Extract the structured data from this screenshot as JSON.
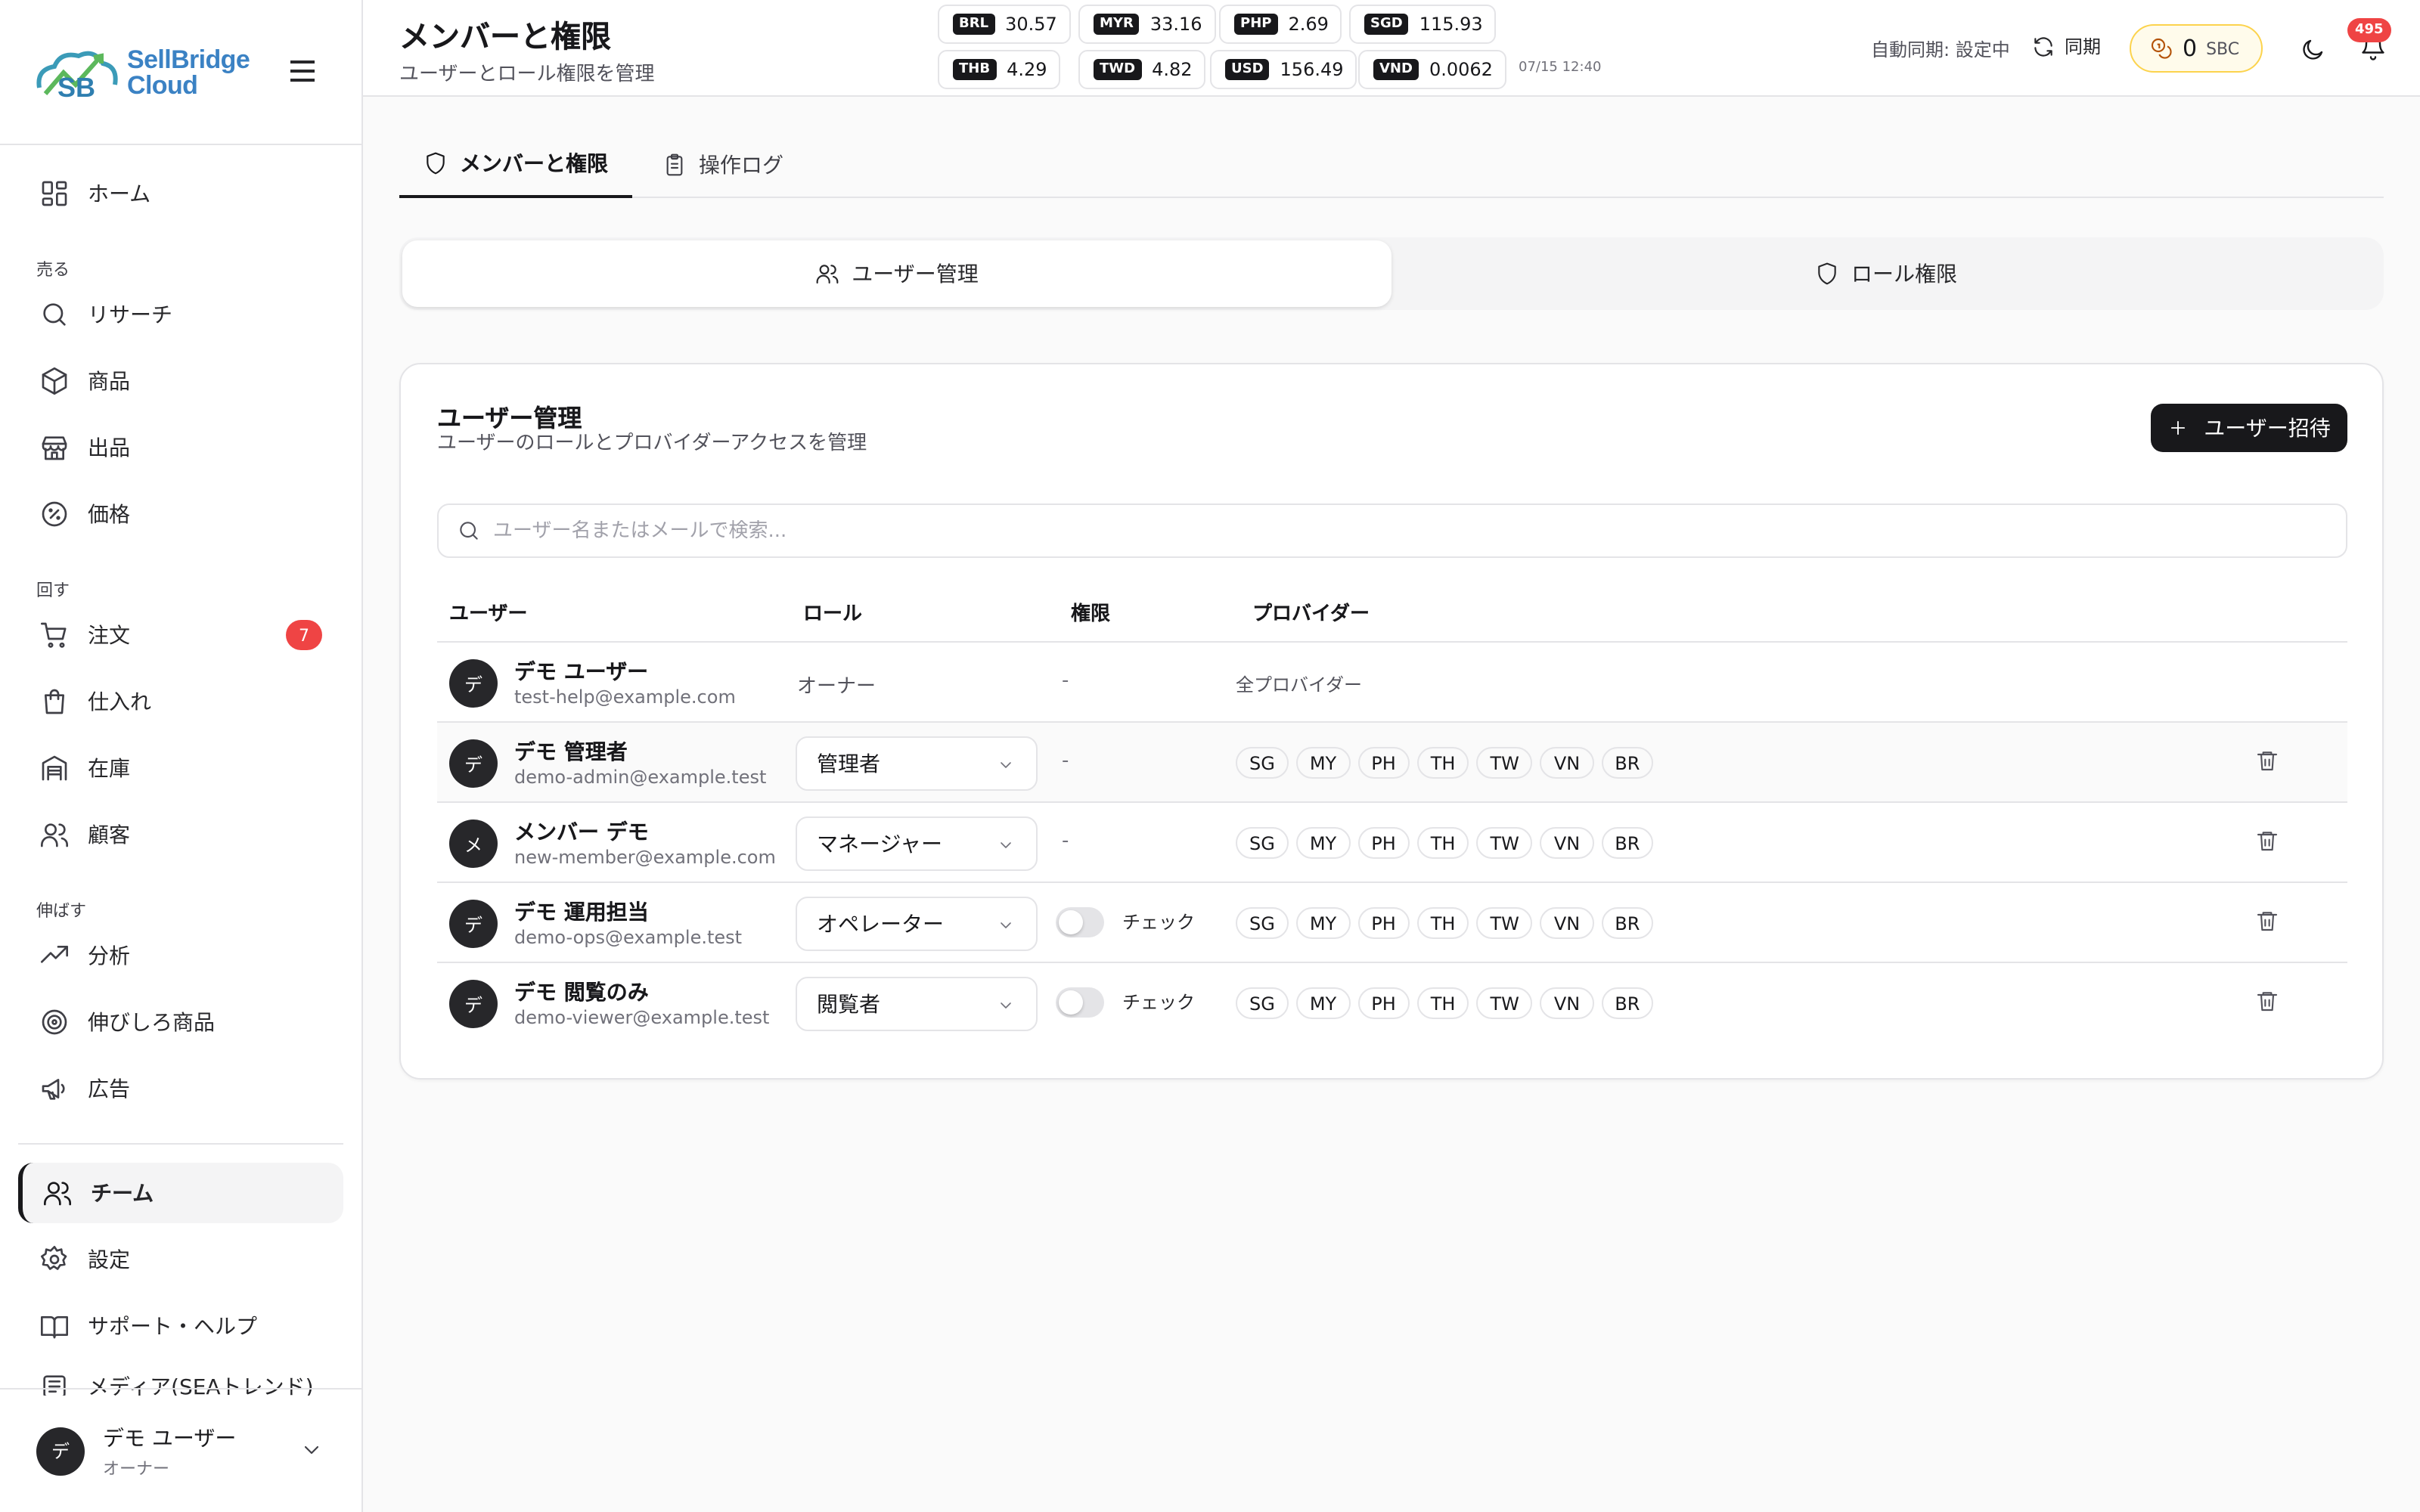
{
  "app": {
    "logo_line1": "SellBridge",
    "logo_line2": "Cloud"
  },
  "sidebar": {
    "home": "ホーム",
    "section_sell": "売る",
    "research": "リサーチ",
    "products": "商品",
    "listing": "出品",
    "pricing": "価格",
    "section_turn": "回す",
    "orders": "注文",
    "orders_badge": "7",
    "purchasing": "仕入れ",
    "inventory": "在庫",
    "customers": "顧客",
    "section_grow": "伸ばす",
    "analytics": "分析",
    "growth_products": "伸びしろ商品",
    "ads": "広告",
    "team": "チーム",
    "settings": "設定",
    "support": "サポート・ヘルプ",
    "media": "メディア(SEAトレンド)",
    "user_name": "デモ ユーザー",
    "user_role": "オーナー",
    "user_initial": "デ"
  },
  "header": {
    "title": "メンバーと権限",
    "subtitle": "ユーザーとロール権限を管理",
    "rates": [
      {
        "code": "BRL",
        "value": "30.57"
      },
      {
        "code": "MYR",
        "value": "33.16"
      },
      {
        "code": "PHP",
        "value": "2.69"
      },
      {
        "code": "SGD",
        "value": "115.93"
      },
      {
        "code": "THB",
        "value": "4.29"
      },
      {
        "code": "TWD",
        "value": "4.82"
      },
      {
        "code": "USD",
        "value": "156.49"
      },
      {
        "code": "VND",
        "value": "0.0062"
      }
    ],
    "rate_time": "07/15 12:40",
    "auto_sync": "自動同期: 設定中",
    "sync_label": "同期",
    "sbc_amount": "0",
    "sbc_unit": "SBC",
    "notif_count": "495"
  },
  "tabs": {
    "members": "メンバーと権限",
    "oplog": "操作ログ"
  },
  "segment": {
    "users": "ユーザー管理",
    "roles": "ロール権限"
  },
  "card": {
    "title": "ユーザー管理",
    "subtitle": "ユーザーのロールとプロバイダーアクセスを管理",
    "invite_label": "ユーザー招待",
    "search_placeholder": "ユーザー名またはメールで検索..."
  },
  "table": {
    "headers": [
      "ユーザー",
      "ロール",
      "権限",
      "プロバイダー"
    ],
    "rows": [
      {
        "initial": "デ",
        "name": "デモ ユーザー",
        "email": "test-help@example.com",
        "role": "オーナー",
        "permission": "-",
        "providers_text": "全プロバイダー"
      },
      {
        "initial": "デ",
        "name": "デモ 管理者",
        "email": "demo-admin@example.test",
        "role": "管理者",
        "permission": "-"
      },
      {
        "initial": "メ",
        "name": "メンバー デモ",
        "email": "new-member@example.com",
        "role": "マネージャー",
        "permission": "-"
      },
      {
        "initial": "デ",
        "name": "デモ 運用担当",
        "email": "demo-ops@example.test",
        "role": "オペレーター",
        "permission": "チェック"
      },
      {
        "initial": "デ",
        "name": "デモ 閲覧のみ",
        "email": "demo-viewer@example.test",
        "role": "閲覧者",
        "permission": "チェック"
      }
    ],
    "providers": [
      "SG",
      "MY",
      "PH",
      "TH",
      "TW",
      "VN",
      "BR"
    ]
  }
}
